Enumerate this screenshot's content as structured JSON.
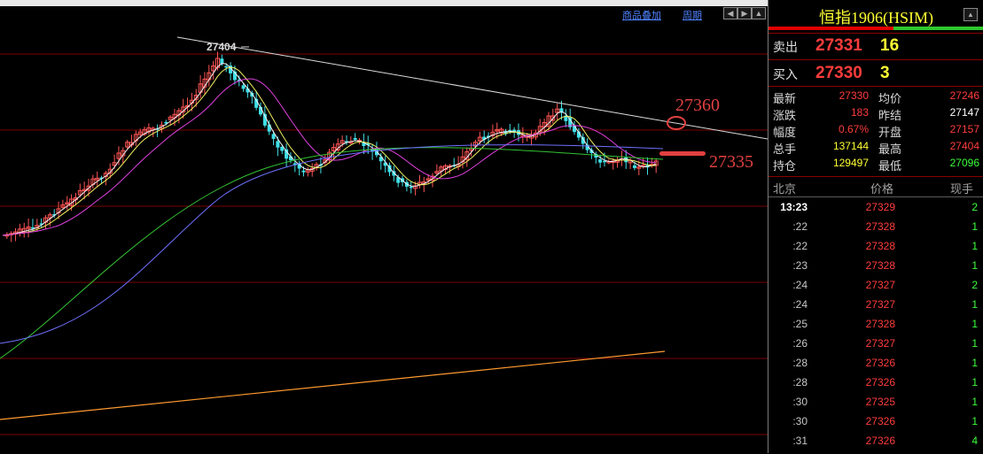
{
  "toolbar": {
    "overlay_label": "商品叠加",
    "period_label": "周期",
    "nav_icons": [
      "arrow-left-box-icon",
      "arrow-right-box-icon",
      "arrow-up-box-icon"
    ]
  },
  "chart": {
    "high_marker_label": "27404",
    "annotation_upper": "27360",
    "annotation_lower": "27335",
    "colors": {
      "candle_up": "#ff5555",
      "candle_down": "#40e0e8",
      "ma_white": "#f0f0f0",
      "ma_yellow": "#f0f060",
      "ma_magenta": "#e040e0",
      "ma_green": "#33c433",
      "ma_blue": "#7070ff",
      "ma_orange": "#ff9a30",
      "trendline": "#dcdcdc",
      "annotation": "#e04040",
      "grid": "#7a0000"
    }
  },
  "side": {
    "title": "恒指1906(HSIM)",
    "ask": {
      "label": "卖出",
      "price": "27331",
      "vol": "16"
    },
    "bid": {
      "label": "买入",
      "price": "27330",
      "vol": "3"
    },
    "stats": [
      {
        "l_label": "最新",
        "l_value": "27330",
        "l_color": "#ff3c3c",
        "r_label": "均价",
        "r_value": "27246",
        "r_color": "#ff3c3c"
      },
      {
        "l_label": "涨跌",
        "l_value": "183",
        "l_color": "#ff3c3c",
        "r_label": "昨结",
        "r_value": "27147",
        "r_color": "#ffffff"
      },
      {
        "l_label": "幅度",
        "l_value": "0.67%",
        "l_color": "#ff3c3c",
        "r_label": "开盘",
        "r_value": "27157",
        "r_color": "#ff3c3c"
      },
      {
        "l_label": "总手",
        "l_value": "137144",
        "l_color": "#ffff33",
        "r_label": "最高",
        "r_value": "27404",
        "r_color": "#ff3c3c"
      },
      {
        "l_label": "持仓",
        "l_value": "129497",
        "l_color": "#ffff33",
        "r_label": "最低",
        "r_value": "27096",
        "r_color": "#3cff3c"
      }
    ],
    "ticks_header": {
      "time": "北京",
      "price": "价格",
      "vol": "现手"
    },
    "ticks": [
      {
        "time": "13:23",
        "price": "27329",
        "vol": "2"
      },
      {
        "time": ":22",
        "price": "27328",
        "vol": "1"
      },
      {
        "time": ":22",
        "price": "27328",
        "vol": "1"
      },
      {
        "time": ":23",
        "price": "27328",
        "vol": "1"
      },
      {
        "time": ":24",
        "price": "27327",
        "vol": "2"
      },
      {
        "time": ":24",
        "price": "27327",
        "vol": "1"
      },
      {
        "time": ":25",
        "price": "27328",
        "vol": "1"
      },
      {
        "time": ":26",
        "price": "27327",
        "vol": "1"
      },
      {
        "time": ":28",
        "price": "27326",
        "vol": "1"
      },
      {
        "time": ":28",
        "price": "27326",
        "vol": "1"
      },
      {
        "time": ":30",
        "price": "27325",
        "vol": "1"
      },
      {
        "time": ":30",
        "price": "27326",
        "vol": "1"
      },
      {
        "time": ":31",
        "price": "27326",
        "vol": "4"
      }
    ]
  }
}
